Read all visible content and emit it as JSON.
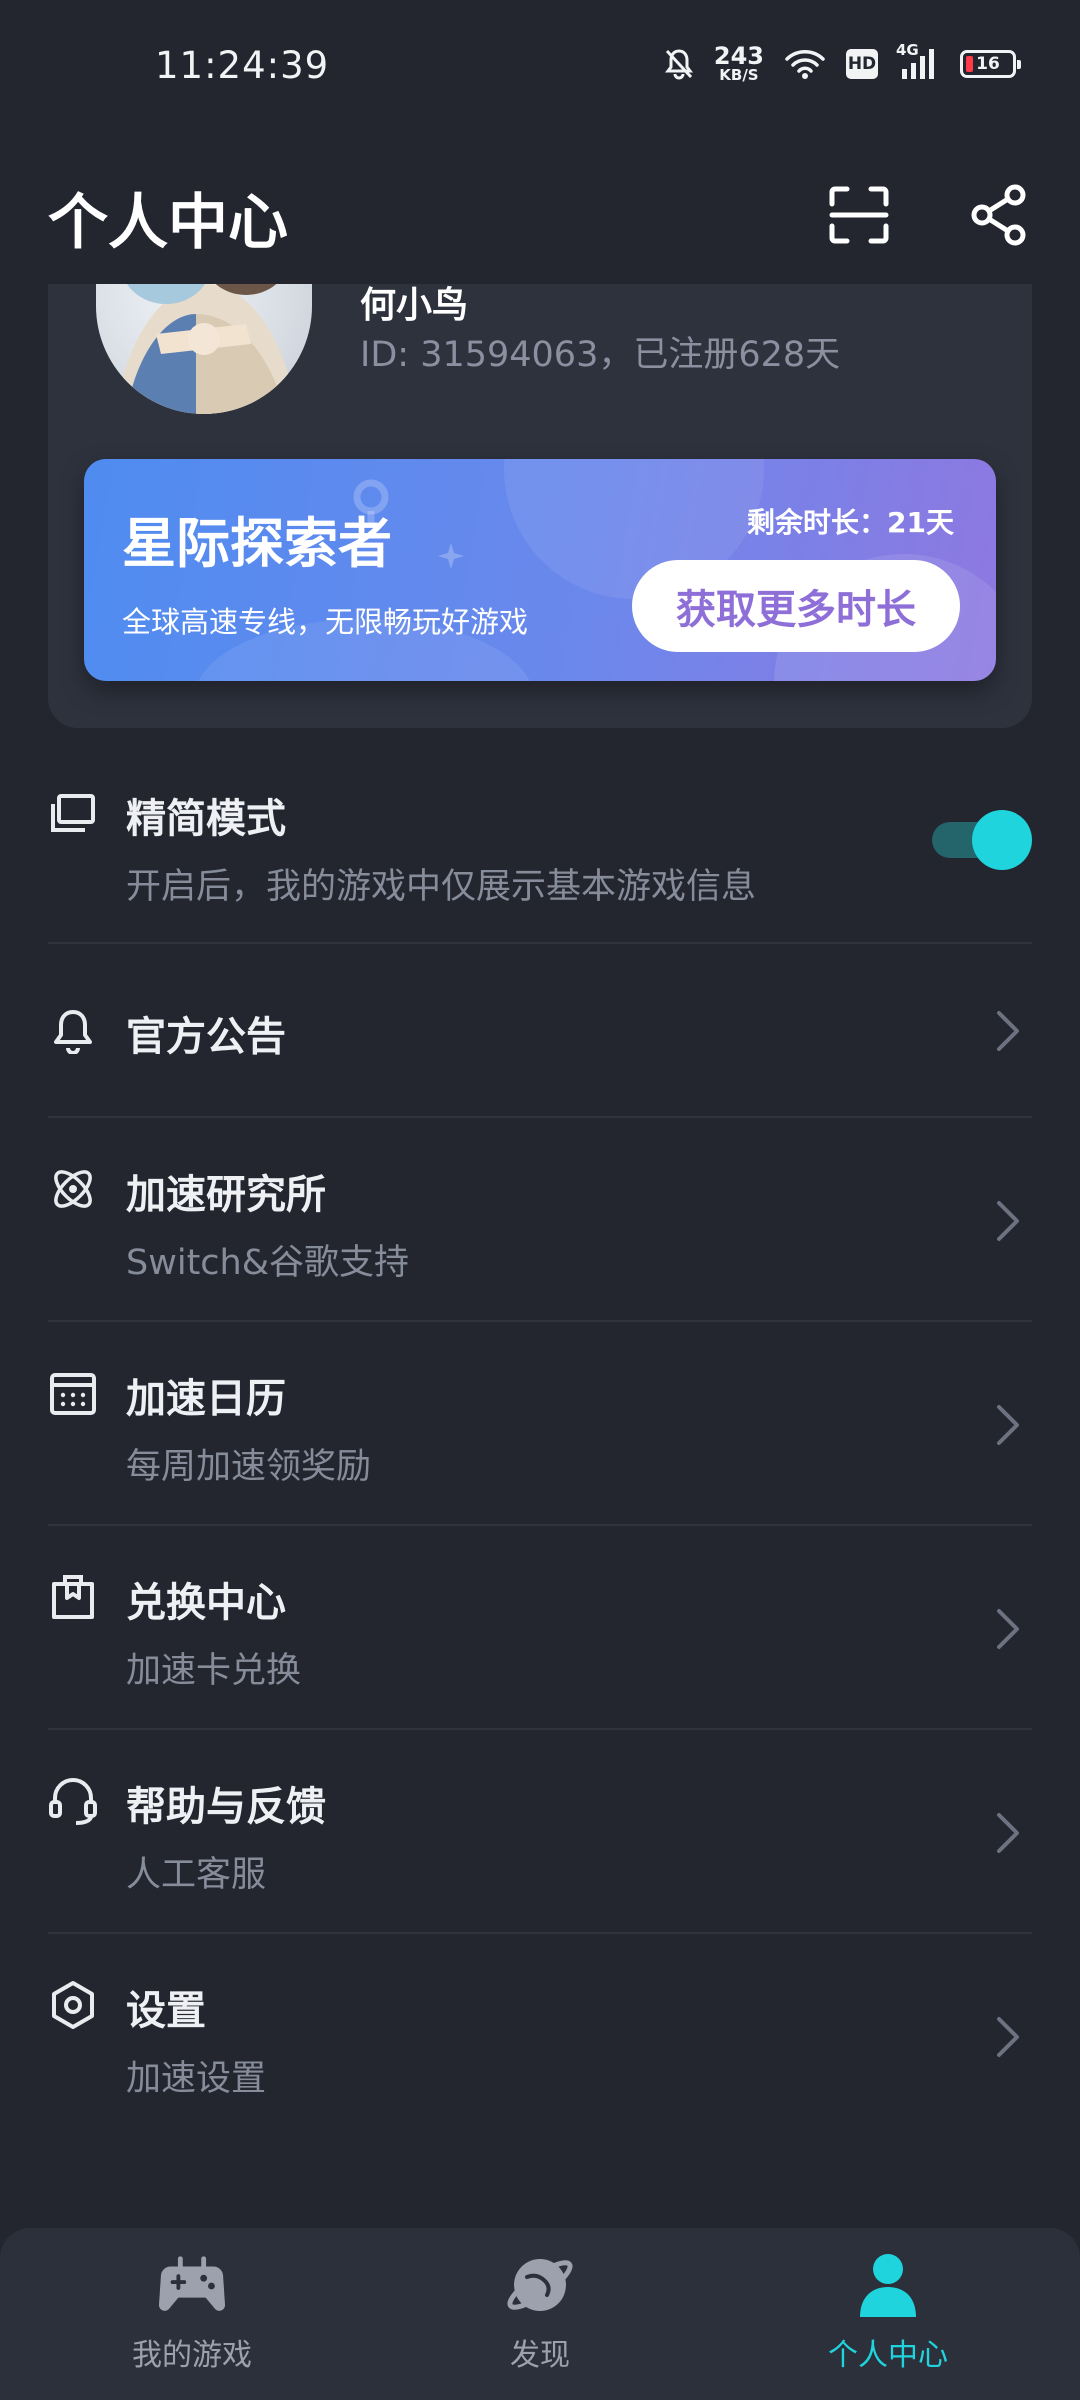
{
  "status_bar": {
    "time": "11:24:39",
    "net_speed_value": "243",
    "net_speed_unit": "KB/S",
    "hd_label": "HD",
    "network_type": "4G",
    "battery_level": "16"
  },
  "header": {
    "title": "个人中心",
    "scan_icon": "scan-icon",
    "share_icon": "share-icon"
  },
  "profile": {
    "username_partial": "何小鸟",
    "user_id_text": "ID: 31594063，已注册628天"
  },
  "vip_banner": {
    "title": "星际探索者",
    "subtitle": "全球高速专线，无限畅玩好游戏",
    "remaining_text": "剩余时长：21天",
    "button_label": "获取更多时长"
  },
  "menu": {
    "simple_mode": {
      "title": "精简模式",
      "subtitle": "开启后，我的游戏中仅展示基本游戏信息",
      "enabled": true,
      "icon": "simple-mode-icon"
    },
    "announcement": {
      "title": "官方公告",
      "icon": "bell-icon"
    },
    "lab": {
      "title": "加速研究所",
      "subtitle": "Switch&谷歌支持",
      "icon": "atom-icon"
    },
    "calendar": {
      "title": "加速日历",
      "subtitle": "每周加速领奖励",
      "icon": "calendar-icon"
    },
    "exchange": {
      "title": "兑换中心",
      "subtitle": "加速卡兑换",
      "icon": "exchange-icon"
    },
    "help": {
      "title": "帮助与反馈",
      "subtitle": "人工客服",
      "icon": "headset-icon"
    },
    "settings": {
      "title": "设置",
      "subtitle": "加速设置",
      "icon": "settings-icon"
    }
  },
  "bottom_nav": {
    "items": [
      {
        "label": "我的游戏",
        "icon": "gamepad-icon",
        "active": false
      },
      {
        "label": "发现",
        "icon": "planet-icon",
        "active": false
      },
      {
        "label": "个人中心",
        "icon": "person-icon",
        "active": true
      }
    ]
  },
  "colors": {
    "background": "#23262f",
    "card": "#2e323d",
    "accent": "#1fd4dc",
    "banner_start": "#4f8cf0",
    "banner_end": "#8e78e0",
    "button_text": "#8e6fd8"
  }
}
